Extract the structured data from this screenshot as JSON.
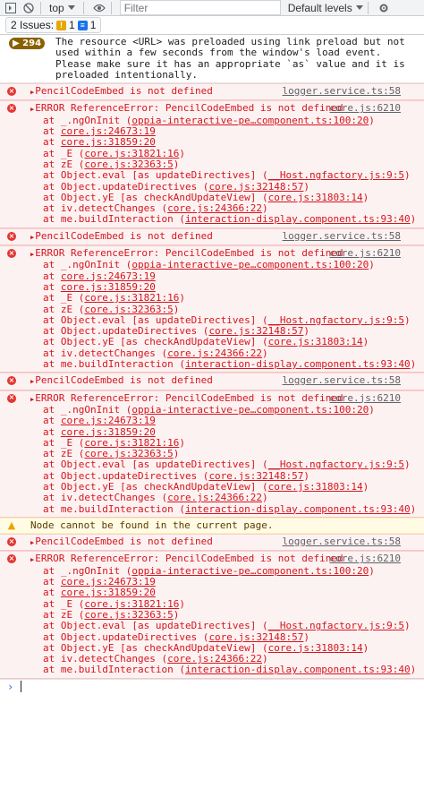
{
  "toolbar": {
    "context": "top",
    "filter_placeholder": "Filter",
    "levels": "Default levels"
  },
  "issues": {
    "label": "2 Issues:",
    "warnings": "1",
    "infos": "1"
  },
  "verbose": {
    "count": "294",
    "text": "The resource <URL> was preloaded using link preload but not used within a few seconds from the window's load event. Please make sure it has an appropriate `as` value and it is preloaded intentionally."
  },
  "messages": [
    {
      "kind": "error",
      "text": "PencilCodeEmbed is not defined",
      "src": "logger.service.ts:58"
    },
    {
      "kind": "error",
      "text": "ERROR ReferenceError: PencilCodeEmbed is not defined",
      "src": "core.js:6210"
    },
    {
      "kind": "error",
      "text": "PencilCodeEmbed is not defined",
      "src": "logger.service.ts:58"
    },
    {
      "kind": "error",
      "text": "ERROR ReferenceError: PencilCodeEmbed is not defined",
      "src": "core.js:6210"
    },
    {
      "kind": "error",
      "text": "PencilCodeEmbed is not defined",
      "src": "logger.service.ts:58"
    },
    {
      "kind": "error",
      "text": "ERROR ReferenceError: PencilCodeEmbed is not defined",
      "src": "core.js:6210"
    },
    {
      "kind": "warning",
      "text": "Node cannot be found in the current page."
    },
    {
      "kind": "error",
      "text": "PencilCodeEmbed is not defined",
      "src": "logger.service.ts:58"
    },
    {
      "kind": "error",
      "text": "ERROR ReferenceError: PencilCodeEmbed is not defined",
      "src": "core.js:6210"
    }
  ],
  "stack": [
    {
      "pre": "at _.ngOnInit (",
      "link": "oppia-interactive-pe…component.ts:100:20",
      "post": ")"
    },
    {
      "pre": "at ",
      "link": "core.js:24673:19",
      "post": ""
    },
    {
      "pre": "at ",
      "link": "core.js:31859:20",
      "post": ""
    },
    {
      "pre": "at _E (",
      "link": "core.js:31821:16",
      "post": ")"
    },
    {
      "pre": "at zE (",
      "link": "core.js:32363:5",
      "post": ")"
    },
    {
      "pre": "at Object.eval [as updateDirectives] (",
      "link": "__Host.ngfactory.js:9:5",
      "post": ")"
    },
    {
      "pre": "at Object.updateDirectives (",
      "link": "core.js:32148:57",
      "post": ")"
    },
    {
      "pre": "at Object.yE [as checkAndUpdateView] (",
      "link": "core.js:31803:14",
      "post": ")"
    },
    {
      "pre": "at iv.detectChanges (",
      "link": "core.js:24366:22",
      "post": ")"
    },
    {
      "pre": "at me.buildInteraction (",
      "link": "interaction-display.component.ts:93:40",
      "post": ")"
    }
  ]
}
